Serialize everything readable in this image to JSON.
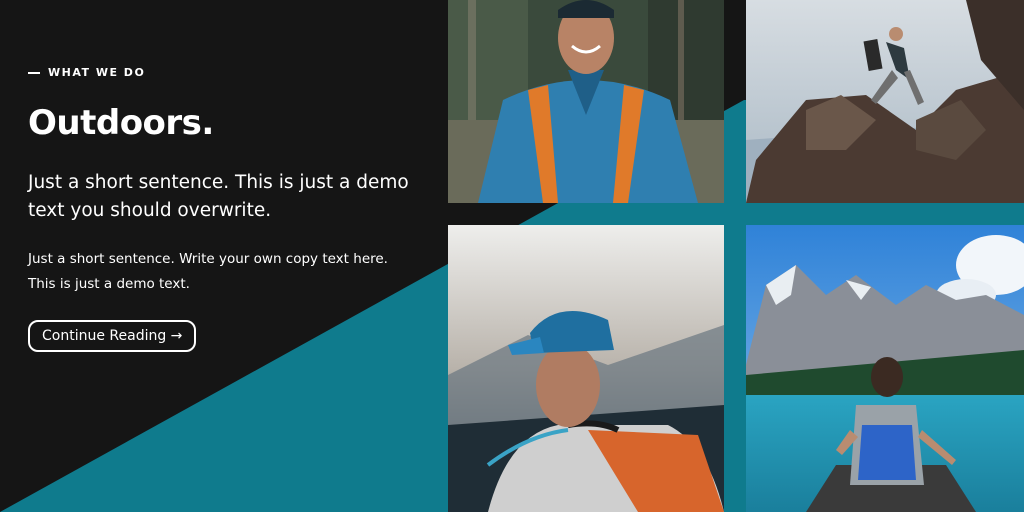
{
  "section": {
    "eyebrow": "WHAT WE DO",
    "title": "Outdoors.",
    "lead": "Just a short sentence. This is just a demo text you should overwrite.",
    "body": "Just a short sentence. Write your own copy text here. This is just a demo text.",
    "cta_label": "Continue Reading →"
  },
  "colors": {
    "background": "#151515",
    "accent_teal": "#0f7b8d",
    "text": "#ffffff"
  },
  "gallery": [
    {
      "name": "smiling-hiker-photo"
    },
    {
      "name": "climber-on-rocks-photo"
    },
    {
      "name": "hiker-with-cap-photo"
    },
    {
      "name": "kayaker-on-lake-photo"
    }
  ]
}
